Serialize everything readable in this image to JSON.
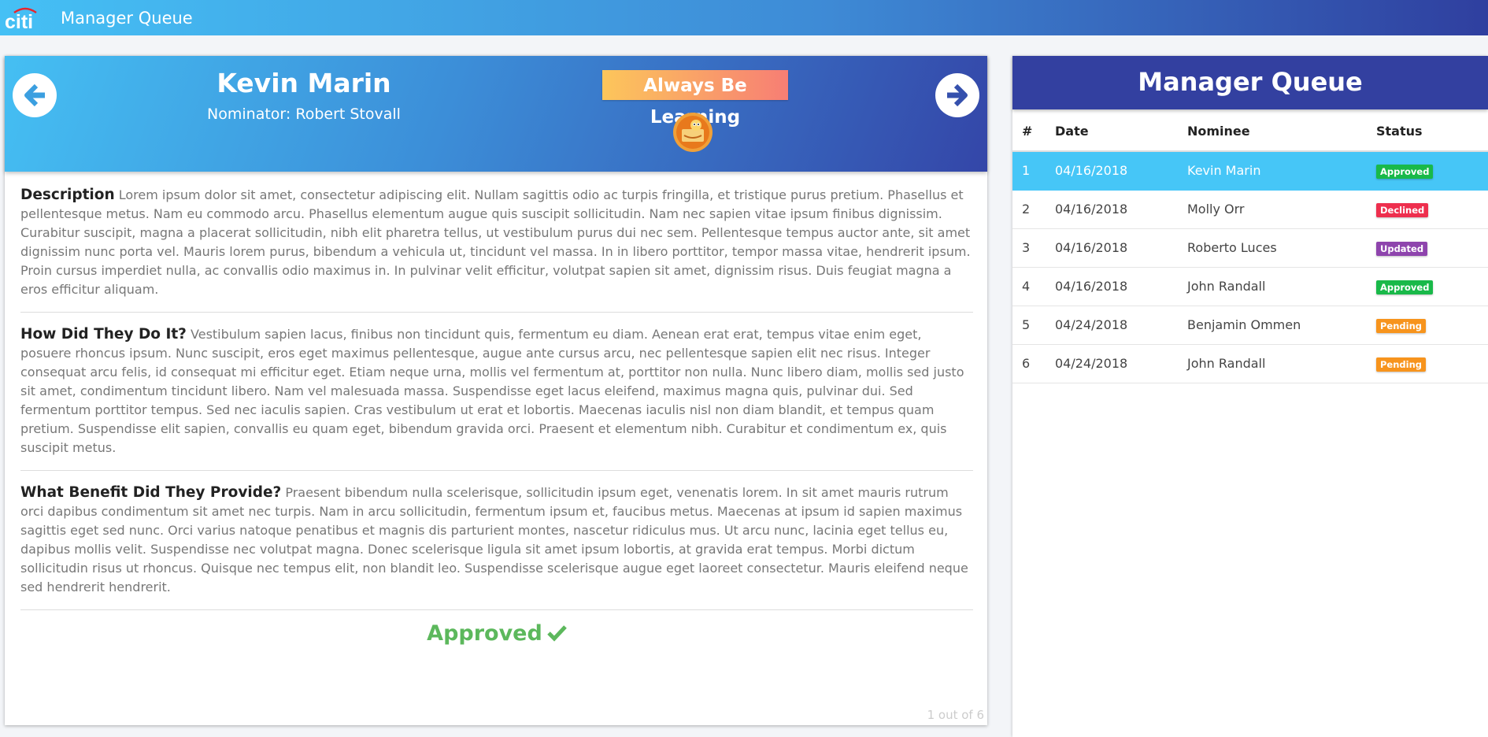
{
  "topbar": {
    "logo_text": "citi",
    "title": "Manager Queue"
  },
  "detail": {
    "nominee_name": "Kevin Marin",
    "nominator": "Nominator: Robert Stovall",
    "award": "Always Be Learning",
    "award_icon": "reading-bookworm-icon",
    "sections": [
      {
        "title": "Description",
        "text": "Lorem ipsum dolor sit amet, consectetur adipiscing elit. Nullam sagittis odio ac turpis fringilla, et tristique purus pretium. Phasellus et pellentesque metus. Nam eu commodo arcu. Phasellus elementum augue quis suscipit sollicitudin. Nam nec sapien vitae ipsum finibus dignissim. Curabitur suscipit, magna a placerat sollicitudin, nibh elit pharetra tellus, ut vestibulum purus dui nec sem. Pellentesque tempus auctor ante, sit amet dignissim nunc porta vel. Mauris lorem purus, bibendum a vehicula ut, tincidunt vel massa. In in libero porttitor, tempor massa vitae, hendrerit ipsum. Proin cursus imperdiet nulla, ac convallis odio maximus in. In pulvinar velit efficitur, volutpat sapien sit amet, dignissim risus. Duis feugiat magna a eros efficitur aliquam."
      },
      {
        "title": "How Did They Do It?",
        "text": "Vestibulum sapien lacus, finibus non tincidunt quis, fermentum eu diam. Aenean erat erat, tempus vitae enim eget, posuere rhoncus ipsum. Nunc suscipit, eros eget maximus pellentesque, augue ante cursus arcu, nec pellentesque sapien elit nec risus. Integer consequat arcu felis, id consequat mi efficitur eget. Etiam neque urna, mollis vel fermentum at, porttitor non nulla. Nunc libero diam, mollis sed justo sit amet, condimentum tincidunt libero. Nam vel malesuada massa. Suspendisse eget lacus eleifend, maximus magna quis, pulvinar dui. Sed fermentum porttitor tempus. Sed nec iaculis sapien. Cras vestibulum ut erat et lobortis. Maecenas iaculis nisl non diam blandit, et tempus quam pretium. Suspendisse elit sapien, convallis eu quam eget, bibendum gravida orci. Praesent et elementum nibh. Curabitur et condimentum ex, quis suscipit metus."
      },
      {
        "title": "What Benefit Did They Provide?",
        "text": "Praesent bibendum nulla scelerisque, sollicitudin ipsum eget, venenatis lorem. In sit amet mauris rutrum orci dapibus condimentum sit amet nec turpis. Nam in arcu sollicitudin, fermentum ipsum et, faucibus metus. Maecenas at ipsum id sapien maximus sagittis eget sed nunc. Orci varius natoque penatibus et magnis dis parturient montes, nascetur ridiculus mus. Ut arcu nunc, lacinia eget tellus eu, dapibus mollis velit. Suspendisse nec volutpat magna. Donec scelerisque ligula sit amet ipsum lobortis, at gravida erat tempus. Morbi dictum sollicitudin risus ut rhoncus. Quisque nec tempus elit, non blandit leo. Suspendisse scelerisque augue eget laoreet consectetur. Mauris eleifend neque sed hendrerit hendrerit."
      }
    ],
    "status": "Approved",
    "status_color": "#5cb85c",
    "pager": "1 out of 6"
  },
  "queue": {
    "title": "Manager Queue",
    "columns": [
      "#",
      "Date",
      "Nominee",
      "Status"
    ],
    "rows": [
      {
        "num": "1",
        "date": "04/16/2018",
        "nominee": "Kevin Marin",
        "status": "Approved",
        "color": "#19b949",
        "active": true
      },
      {
        "num": "2",
        "date": "04/16/2018",
        "nominee": "Molly Orr",
        "status": "Declined",
        "color": "#ee2f4e",
        "active": false
      },
      {
        "num": "3",
        "date": "04/16/2018",
        "nominee": "Roberto Luces",
        "status": "Updated",
        "color": "#8e44ad",
        "active": false
      },
      {
        "num": "4",
        "date": "04/16/2018",
        "nominee": "John Randall",
        "status": "Approved",
        "color": "#19b949",
        "active": false
      },
      {
        "num": "5",
        "date": "04/24/2018",
        "nominee": "Benjamin Ommen",
        "status": "Pending",
        "color": "#f7941d",
        "active": false
      },
      {
        "num": "6",
        "date": "04/24/2018",
        "nominee": "John Randall",
        "status": "Pending",
        "color": "#f7941d",
        "active": false
      }
    ]
  }
}
